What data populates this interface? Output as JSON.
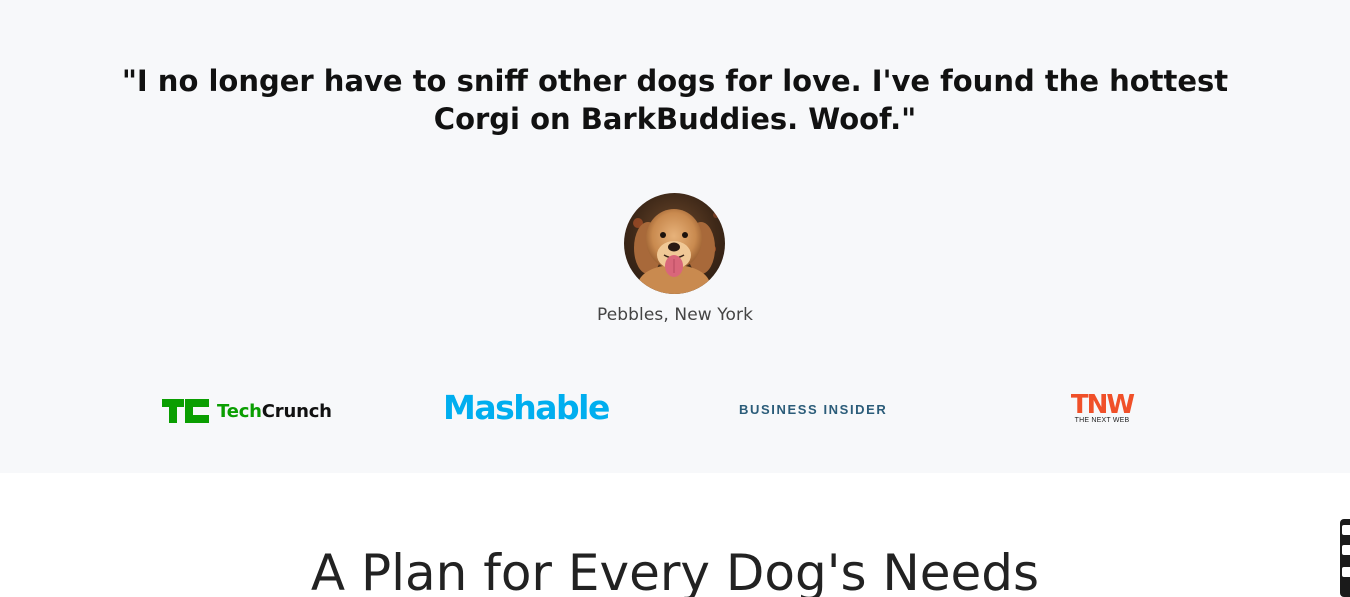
{
  "testimonial": {
    "quote": "\"I no longer have to sniff other dogs for love. I've found the hottest Corgi on BarkBuddies. Woof.\"",
    "author": "Pebbles, New York",
    "avatar_icon": "golden-retriever-photo"
  },
  "press_logos": {
    "techcrunch": {
      "tech": "Tech",
      "crunch": "Crunch",
      "color": "#0a9e01"
    },
    "mashable": {
      "text": "Mashable",
      "color": "#00aeef"
    },
    "business_insider": {
      "text": "BUSINESS INSIDER",
      "color": "#2b5c79"
    },
    "tnw": {
      "text": "TNW",
      "subtext": "THE NEXT WEB",
      "color": "#f05029"
    }
  },
  "plans": {
    "title": "A Plan for Every Dog's Needs"
  },
  "colors": {
    "section_bg": "#f7f8fa",
    "page_bg": "#ffffff"
  }
}
